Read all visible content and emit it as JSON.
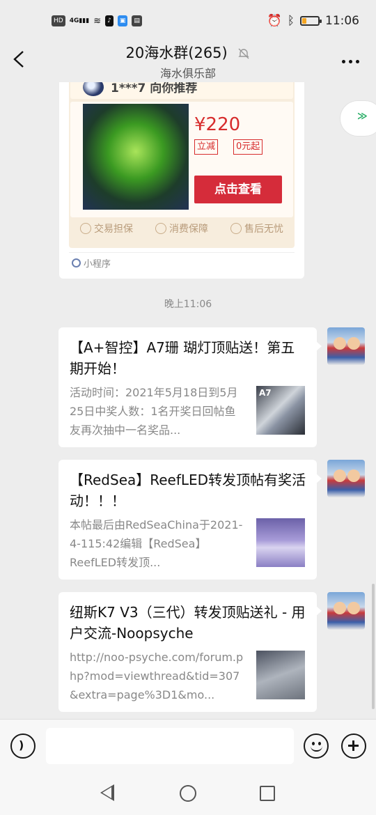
{
  "status_bar": {
    "left_badges": [
      "HD",
      "4G",
      "itl",
      "wifi",
      "TT",
      "QQ",
      "ER"
    ],
    "time": "11:06",
    "battery_level": 0.25,
    "battery_color": "#f5a623"
  },
  "header": {
    "title": "20海水群(265)",
    "subtitle": "海水俱乐部",
    "back_icon": "chevron-left-icon",
    "more_icon": "more-dots-icon"
  },
  "mini_program_card": {
    "recommend_text": "1***7 向你推荐",
    "price": "¥220",
    "tag1": "立减",
    "tag2": "0元起",
    "button": "点击查看",
    "guarantees": [
      "交易担保",
      "消费保障",
      "售后无忧"
    ],
    "footer_label": "小程序"
  },
  "scroll_to_bottom": "≫",
  "timestamp": "晚上11:06",
  "messages": [
    {
      "title": "【A+智控】A7珊 瑚灯顶贴送！第五期开始！",
      "desc": "活动时间：2021年5月18日到5月25日中奖人数：1名开奖日回帖鱼友再次抽中一名奖品...",
      "thumb_label": "A7"
    },
    {
      "title": "【RedSea】ReefLED转发顶帖有奖活动！！！",
      "desc": "本帖最后由RedSeaChina于2021-4-115:42编辑【RedSea】ReefLED转发顶...",
      "thumb_label": ""
    },
    {
      "title": "纽斯K7 V3（三代）转发顶贴送礼 - 用户交流-Noopsyche",
      "desc": "http://noo-psyche.com/forum.php?mod=viewthread&tid=307&extra=page%3D1&mo...",
      "thumb_label": ""
    }
  ],
  "input_bar": {
    "placeholder": "",
    "voice_icon": "voice-icon",
    "emoji_icon": "emoji-icon",
    "plus_icon": "plus-icon"
  },
  "nav_bar": {
    "back_icon": "nav-back-icon",
    "home_icon": "nav-home-icon",
    "recent_icon": "nav-recent-icon"
  }
}
